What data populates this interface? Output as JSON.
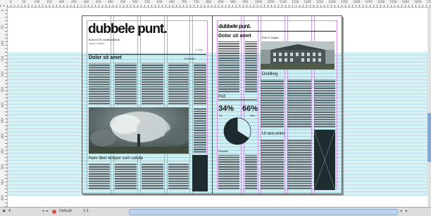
{
  "ruler": {
    "top_ticks": [
      "0",
      "50",
      "100",
      "150",
      "200",
      "250",
      "300",
      "350",
      "400",
      "450",
      "500",
      "550",
      "600",
      "650",
      "700",
      "750",
      "800",
      "850",
      "900",
      "950",
      "1000",
      "1050",
      "1100",
      "1150",
      "1200",
      "1250",
      "1300",
      "1350",
      "1400",
      "1450",
      "1500",
      "1550",
      "1600",
      "1650",
      "1700"
    ],
    "left_ticks": [
      "0",
      "50",
      "100",
      "150",
      "200",
      "250",
      "300",
      "350",
      "400",
      "450",
      "500",
      "550",
      "600"
    ]
  },
  "left_page": {
    "masthead": "dubbele punt.",
    "subtitle": "kritisch & onafhankelijk",
    "tagline": "ingang tot snimmo",
    "edition": "1e uitgave",
    "headline": "Dolor sit amet",
    "side_heading": "Dolatinm",
    "bottom_heading": "Nam liber tempor cum soluta"
  },
  "right_page": {
    "masthead": "dubbele punt.",
    "headline": "Dolor sit amet",
    "photo_caption": "Duis te feugiat",
    "heading_distilling": "Distilling",
    "heading_poll": "Poll",
    "stat_left": {
      "value": "34%",
      "label": "Ja"
    },
    "stat_right": {
      "value": "66%",
      "label": "Nee"
    },
    "heading_tiny": "Dolatinu",
    "bottom_heading": "Ut wisi enim"
  },
  "pie": {
    "segments": [
      {
        "label": "Ja",
        "value": 34,
        "color": "#cfeef4"
      },
      {
        "label": "Nee",
        "value": 66,
        "color": "#1d2b2e"
      }
    ]
  },
  "status": {
    "page_number": "4",
    "zoom": "1:1",
    "mode": "Default"
  },
  "colors": {
    "guide": "#b6e2ea",
    "column_guide": "#c79be0",
    "dark": "#1e2c2f"
  }
}
